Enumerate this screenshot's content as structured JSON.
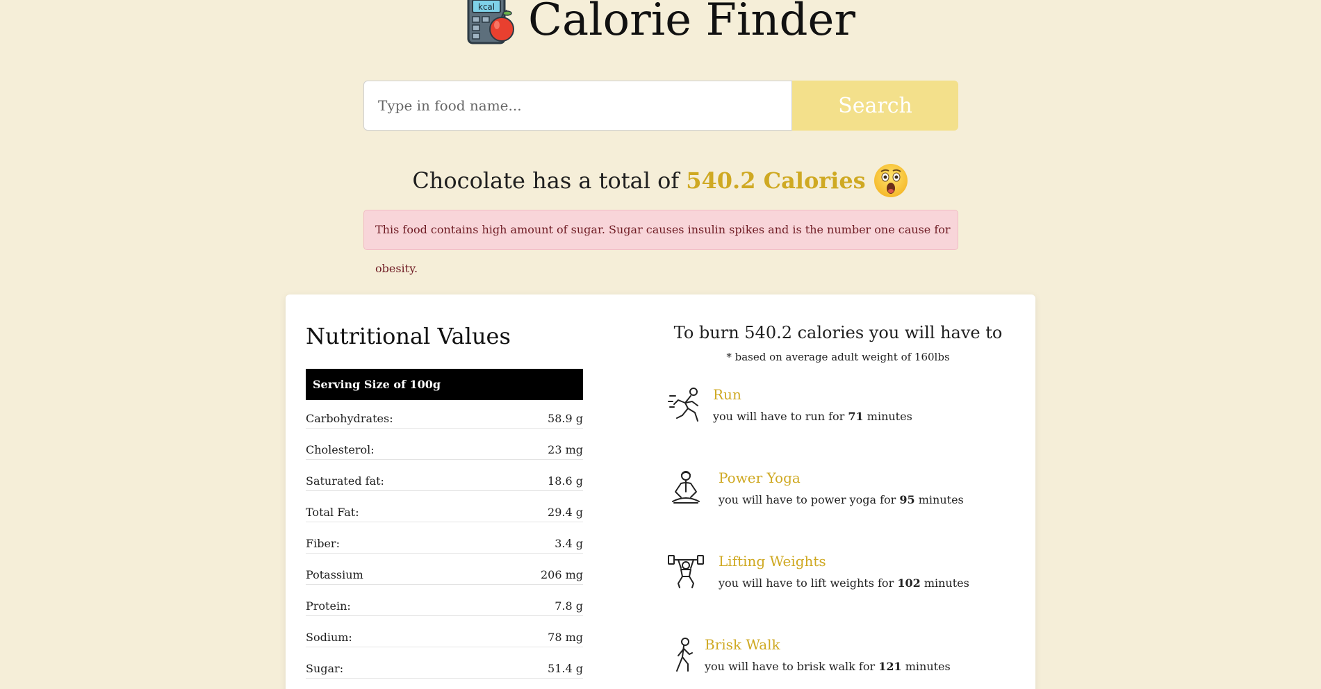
{
  "app": {
    "title": "Calorie Finder",
    "logo_icon": "calculator-apple-icon",
    "logo_label": "kcal"
  },
  "search": {
    "placeholder": "Type in food name...",
    "value": "",
    "button_label": "Search"
  },
  "result": {
    "prefix": "Chocolate has a total of",
    "calories": "540.2 Calories",
    "emoji": "astonished-face-icon"
  },
  "alert": {
    "message": "This food contains high amount of sugar. Sugar causes insulin spikes and is the number one cause for obesity."
  },
  "nutrition": {
    "title": "Nutritional Values",
    "serving": "Serving Size of 100g",
    "items": [
      {
        "label": "Carbohydrates:",
        "value": "58.9 g"
      },
      {
        "label": "Cholesterol:",
        "value": "23 mg"
      },
      {
        "label": "Saturated fat:",
        "value": "18.6 g"
      },
      {
        "label": "Total Fat:",
        "value": "29.4 g"
      },
      {
        "label": "Fiber:",
        "value": "3.4 g"
      },
      {
        "label": "Potassium",
        "value": "206 mg"
      },
      {
        "label": "Protein:",
        "value": "7.8 g"
      },
      {
        "label": "Sodium:",
        "value": "78 mg"
      },
      {
        "label": "Sugar:",
        "value": "51.4 g"
      }
    ]
  },
  "burn": {
    "title": "To burn 540.2 calories you will have to",
    "note": "* based on average adult weight of 160lbs",
    "activities": [
      {
        "name": "Run",
        "icon": "runner-icon",
        "desc_prefix": "you will have to run for",
        "minutes": "71",
        "desc_suffix": "minutes"
      },
      {
        "name": "Power Yoga",
        "icon": "yoga-icon",
        "desc_prefix": "you will have to power yoga for",
        "minutes": "95",
        "desc_suffix": "minutes"
      },
      {
        "name": "Lifting Weights",
        "icon": "weightlifter-icon",
        "desc_prefix": "you will have to lift weights for",
        "minutes": "102",
        "desc_suffix": "minutes"
      },
      {
        "name": "Brisk Walk",
        "icon": "walker-icon",
        "desc_prefix": "you will have to brisk walk for",
        "minutes": "121",
        "desc_suffix": "minutes"
      }
    ]
  },
  "colors": {
    "background": "#f5eed8",
    "accent": "#cfa923",
    "button": "#f3e08b",
    "alert_bg": "#f8d5d9",
    "alert_text": "#6f1c24"
  }
}
